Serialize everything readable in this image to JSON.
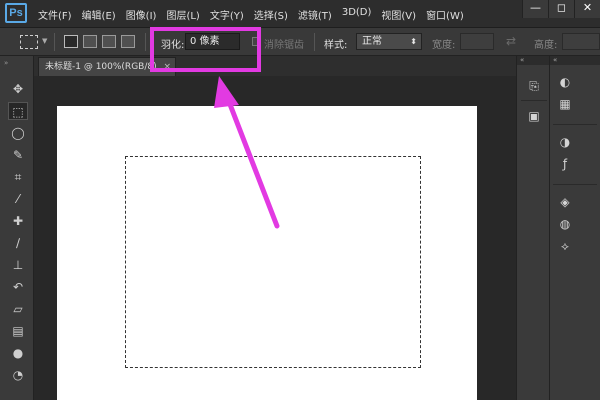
{
  "app": {
    "logo": "Ps"
  },
  "menu": {
    "items": [
      "文件(F)",
      "编辑(E)",
      "图像(I)",
      "图层(L)",
      "文字(Y)",
      "选择(S)",
      "滤镜(T)",
      "3D(D)",
      "视图(V)",
      "窗口(W)"
    ]
  },
  "window_controls": {
    "minimize": "—",
    "restore": "◻",
    "close": "✕"
  },
  "options": {
    "feather_label": "羽化:",
    "feather_value": "0 像素",
    "antialias_label": "消除锯齿",
    "style_label": "样式:",
    "style_value": "正常",
    "width_label": "宽度:",
    "height_label": "高度:"
  },
  "document": {
    "tab_title": "未标题-1 @ 100%(RGB/8)",
    "tab_close": "×"
  },
  "tools": [
    "move-icon",
    "rectangular-marquee-icon",
    "lasso-icon",
    "quick-selection-icon",
    "crop-icon",
    "eyedropper-icon",
    "spot-healing-icon",
    "brush-icon",
    "clone-stamp-icon",
    "history-brush-icon",
    "eraser-icon",
    "gradient-icon",
    "blur-icon",
    "dodge-icon"
  ],
  "colors": {
    "highlight": "#e23ae2",
    "logo": "#5aa9e6",
    "canvas": "#ffffff"
  }
}
